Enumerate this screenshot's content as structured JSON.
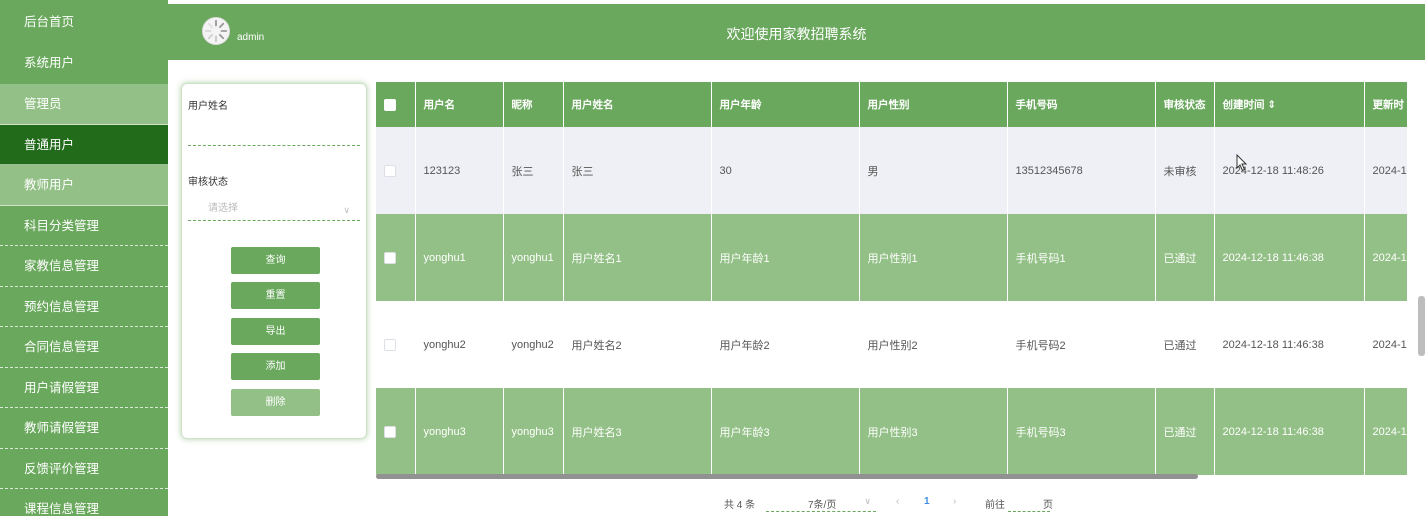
{
  "sidebar": {
    "items": [
      {
        "label": "后台首页"
      },
      {
        "label": "系统用户"
      },
      {
        "label": "管理员"
      },
      {
        "label": "普通用户"
      },
      {
        "label": "教师用户"
      },
      {
        "label": "科目分类管理"
      },
      {
        "label": "家教信息管理"
      },
      {
        "label": "预约信息管理"
      },
      {
        "label": "合同信息管理"
      },
      {
        "label": "用户请假管理"
      },
      {
        "label": "教师请假管理"
      },
      {
        "label": "反馈评价管理"
      },
      {
        "label": "课程信息管理"
      }
    ]
  },
  "header": {
    "username": "admin",
    "title": "欢迎使用家教招聘系统"
  },
  "search": {
    "name_label": "用户姓名",
    "name_value": "",
    "status_label": "审核状态",
    "status_placeholder": "请选择",
    "buttons": {
      "query": "查询",
      "reset": "重置",
      "export": "导出",
      "add": "添加",
      "delete": "删除"
    }
  },
  "table": {
    "columns": [
      "用户名",
      "昵称",
      "用户姓名",
      "用户年龄",
      "用户性别",
      "手机号码",
      "审核状态",
      "创建时间 ⇕",
      "更新时"
    ],
    "rows": [
      [
        "123123",
        "张三",
        "张三",
        "30",
        "男",
        "13512345678",
        "未审核",
        "2024-12-18 11:48:26",
        "2024-1"
      ],
      [
        "yonghu1",
        "yonghu1",
        "用户姓名1",
        "用户年龄1",
        "用户性别1",
        "手机号码1",
        "已通过",
        "2024-12-18 11:46:38",
        "2024-1"
      ],
      [
        "yonghu2",
        "yonghu2",
        "用户姓名2",
        "用户年龄2",
        "用户性别2",
        "手机号码2",
        "已通过",
        "2024-12-18 11:46:38",
        "2024-1"
      ],
      [
        "yonghu3",
        "yonghu3",
        "用户姓名3",
        "用户年龄3",
        "用户性别3",
        "手机号码3",
        "已通过",
        "2024-12-18 11:46:38",
        "2024-1"
      ]
    ]
  },
  "pagination": {
    "total": "共 4 条",
    "page_size": "7条/页",
    "prev": "‹",
    "current": "1",
    "next": "›",
    "goto": "前往",
    "goto_value": "",
    "unit": "页"
  },
  "icons": {
    "avatar": "avatar-icon",
    "dropdown": "chevron-down-icon",
    "checkbox": "checkbox-icon",
    "cursor": "mouse-cursor-icon"
  },
  "colors": {
    "primary": "#6aa85d",
    "light": "#93c086",
    "active": "#226b1b",
    "pager_current": "#3a8ee6"
  }
}
